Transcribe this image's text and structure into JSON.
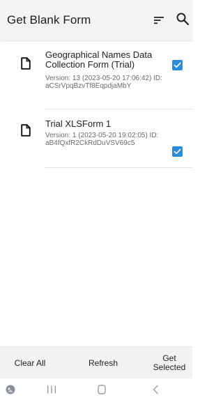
{
  "app_bar": {
    "title": "Get Blank Form",
    "icons": [
      "sort-icon",
      "search-icon"
    ]
  },
  "forms": [
    {
      "name": "Geographical Names Data Collection Form (Trial)",
      "details": "Version: 13 (2023-05-20 17:06:42) ID: aCSrVpqBzvTf8EqpdjaMbY",
      "checked": true,
      "icon": "document-icon"
    },
    {
      "name": "Trial XLSForm 1",
      "details": "Version: 1 (2023-05-20 19:02:05) ID: aB4fQxfR2CkRdDuVSV69c5",
      "checked": true,
      "icon": "document-icon"
    }
  ],
  "bottom_bar": {
    "clear_all": "Clear All",
    "refresh": "Refresh",
    "get_selected_line1": "Get",
    "get_selected_line2": "Selected"
  },
  "nav_bar": {
    "icons": [
      "app-icon",
      "recents-icon",
      "home-icon",
      "back-icon"
    ]
  },
  "colors": {
    "accent": "#2a8bd8",
    "app_bar_bg": "#f3f3f3",
    "bottom_bar_bg": "#f2f2f2",
    "secondary_text": "#6b6b6b"
  }
}
